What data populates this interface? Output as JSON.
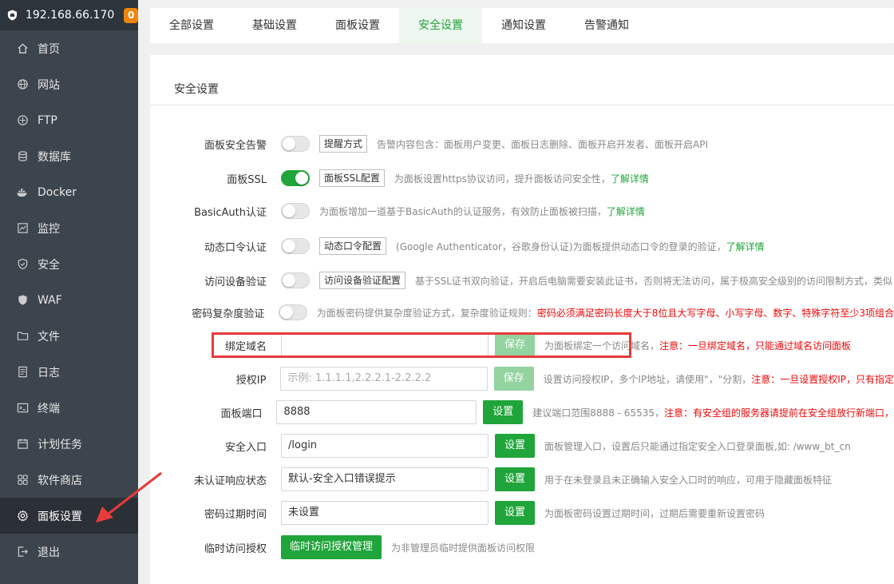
{
  "header": {
    "ip": "192.168.66.170",
    "badge": "0"
  },
  "sidebar": {
    "items": [
      {
        "label": "首页",
        "icon": "home-icon"
      },
      {
        "label": "网站",
        "icon": "globe-icon"
      },
      {
        "label": "FTP",
        "icon": "ftp-icon"
      },
      {
        "label": "数据库",
        "icon": "database-icon"
      },
      {
        "label": "Docker",
        "icon": "docker-icon"
      },
      {
        "label": "监控",
        "icon": "monitor-icon"
      },
      {
        "label": "安全",
        "icon": "shield-icon"
      },
      {
        "label": "WAF",
        "icon": "waf-icon"
      },
      {
        "label": "文件",
        "icon": "folder-icon"
      },
      {
        "label": "日志",
        "icon": "log-icon"
      },
      {
        "label": "终端",
        "icon": "terminal-icon"
      },
      {
        "label": "计划任务",
        "icon": "calendar-icon"
      },
      {
        "label": "软件商店",
        "icon": "apps-icon"
      },
      {
        "label": "面板设置",
        "icon": "gear-icon"
      },
      {
        "label": "退出",
        "icon": "logout-icon"
      }
    ]
  },
  "tabs": [
    "全部设置",
    "基础设置",
    "面板设置",
    "安全设置",
    "通知设置",
    "告警通知"
  ],
  "panel": {
    "title": "安全设置",
    "toggle_rows": [
      {
        "label": "面板安全告警",
        "on": false,
        "button": "提醒方式",
        "desc": "告警内容包含：面板用户变更、面板日志删除、面板开启开发者、面板开启API",
        "link": "",
        "warn": ""
      },
      {
        "label": "面板SSL",
        "on": true,
        "button": "面板SSL配置",
        "desc": "为面板设置https协议访问，提升面板访问安全性，",
        "link": "了解详情",
        "warn": ""
      },
      {
        "label": "BasicAuth认证",
        "on": false,
        "button": "",
        "desc": "为面板增加一道基于BasicAuth的认证服务，有效防止面板被扫描，",
        "link": "了解详情",
        "warn": ""
      },
      {
        "label": "动态口令认证",
        "on": false,
        "button": "动态口令配置",
        "desc": "(Google Authenticator，谷歌身份认证)为面板提供动态口令的登录的验证，",
        "link": "了解详情",
        "warn": ""
      },
      {
        "label": "访问设备验证",
        "on": false,
        "button": "访问设备验证配置",
        "desc": "基于SSL证书双向验证，开启后电脑需要安装此证书，否则将无法访问，属于极高安全级别的访问限制方式，类似",
        "link": "",
        "warn": ""
      },
      {
        "label": "密码复杂度验证",
        "on": false,
        "button": "",
        "desc": "为面板密码提供复杂度验证方式，复杂度验证规则：",
        "link": "",
        "warn": "密码必须满足密码长度大于8位且大写字母、小写字母、数字、特殊字符至少3项组合"
      }
    ],
    "input_rows": [
      {
        "label": "绑定域名",
        "value": "",
        "placeholder": "",
        "button": "保存",
        "disabled": true,
        "desc": "为面板绑定一个访问域名，",
        "warn": "注意：一旦绑定域名，只能通过域名访问面板"
      },
      {
        "label": "授权IP",
        "value": "",
        "placeholder": "示例: 1.1.1.1,2.2.2.1-2.2.2.2",
        "button": "保存",
        "disabled": true,
        "desc": "设置访问授权IP，多个IP地址，请使用\"，\"分割，",
        "warn": "注意：一旦设置授权IP，只有指定"
      },
      {
        "label": "面板端口",
        "value": "8888",
        "placeholder": "",
        "button": "设置",
        "disabled": false,
        "desc": "建议端口范围8888 - 65535，",
        "warn": "注意：有安全组的服务器请提前在安全组放行新端口，"
      },
      {
        "label": "安全入口",
        "value": "/login",
        "placeholder": "",
        "button": "设置",
        "disabled": false,
        "desc": "面板管理入口，设置后只能通过指定安全入口登录面板,如: /www_bt_cn",
        "warn": ""
      },
      {
        "label": "未认证响应状态",
        "value": "默认-安全入口错误提示",
        "placeholder": "",
        "button": "设置",
        "disabled": false,
        "desc": "用于在未登录且未正确输入安全入口时的响应，可用于隐藏面板特征",
        "warn": ""
      },
      {
        "label": "密码过期时间",
        "value": "未设置",
        "placeholder": "",
        "button": "设置",
        "disabled": false,
        "desc": "为面板密码设置过期时间，过期后需要重新设置密码",
        "warn": ""
      }
    ],
    "temp_row": {
      "label": "临时访问授权",
      "button": "临时访问授权管理",
      "desc": "为非管理员临时提供面板访问权限"
    }
  },
  "colors": {
    "accent": "#20a53a",
    "warn": "#ef0808",
    "sidebar": "#3c444d",
    "highlight": "#e83b3b"
  }
}
